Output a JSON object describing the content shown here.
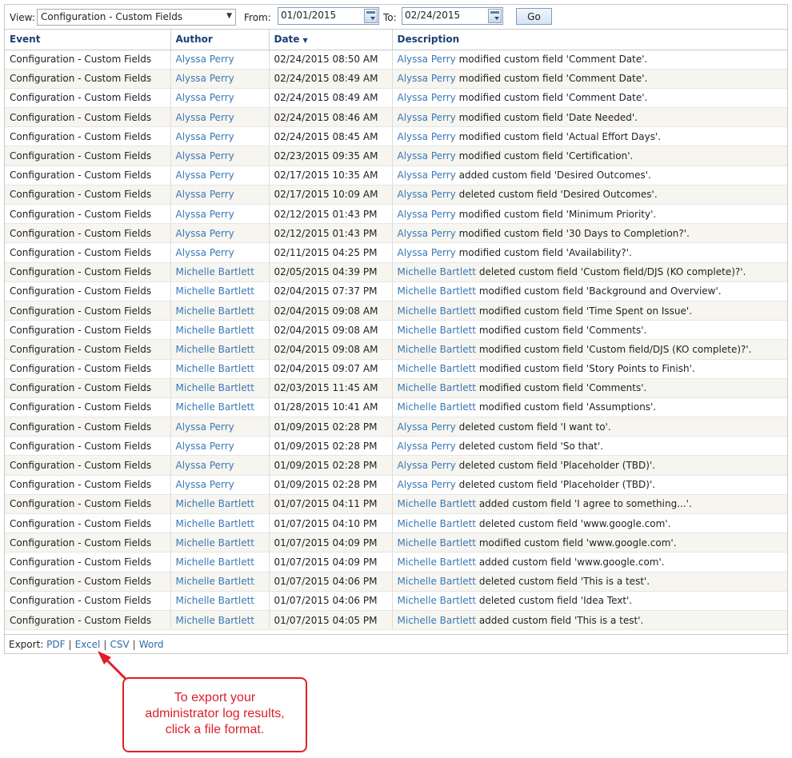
{
  "toolbar": {
    "view_label": "View:",
    "view_value": "Configuration - Custom Fields",
    "from_label": "From:",
    "from_value": "01/01/2015",
    "to_label": "To:",
    "to_value": "02/24/2015",
    "go_label": "Go"
  },
  "columns": {
    "event": "Event",
    "author": "Author",
    "date": "Date",
    "description": "Description"
  },
  "rows": [
    {
      "event": "Configuration - Custom Fields",
      "author": "Alyssa Perry",
      "date": "02/24/2015 08:50 AM",
      "desc": "modified custom field 'Comment Date'."
    },
    {
      "event": "Configuration - Custom Fields",
      "author": "Alyssa Perry",
      "date": "02/24/2015 08:49 AM",
      "desc": "modified custom field 'Comment Date'."
    },
    {
      "event": "Configuration - Custom Fields",
      "author": "Alyssa Perry",
      "date": "02/24/2015 08:49 AM",
      "desc": "modified custom field 'Comment Date'."
    },
    {
      "event": "Configuration - Custom Fields",
      "author": "Alyssa Perry",
      "date": "02/24/2015 08:46 AM",
      "desc": "modified custom field 'Date Needed'."
    },
    {
      "event": "Configuration - Custom Fields",
      "author": "Alyssa Perry",
      "date": "02/24/2015 08:45 AM",
      "desc": "modified custom field 'Actual Effort Days'."
    },
    {
      "event": "Configuration - Custom Fields",
      "author": "Alyssa Perry",
      "date": "02/23/2015 09:35 AM",
      "desc": "modified custom field 'Certification'."
    },
    {
      "event": "Configuration - Custom Fields",
      "author": "Alyssa Perry",
      "date": "02/17/2015 10:35 AM",
      "desc": "added custom field 'Desired Outcomes'."
    },
    {
      "event": "Configuration - Custom Fields",
      "author": "Alyssa Perry",
      "date": "02/17/2015 10:09 AM",
      "desc": "deleted custom field 'Desired Outcomes'."
    },
    {
      "event": "Configuration - Custom Fields",
      "author": "Alyssa Perry",
      "date": "02/12/2015 01:43 PM",
      "desc": "modified custom field 'Minimum Priority'."
    },
    {
      "event": "Configuration - Custom Fields",
      "author": "Alyssa Perry",
      "date": "02/12/2015 01:43 PM",
      "desc": "modified custom field '30 Days to Completion?'."
    },
    {
      "event": "Configuration - Custom Fields",
      "author": "Alyssa Perry",
      "date": "02/11/2015 04:25 PM",
      "desc": "modified custom field 'Availability?'."
    },
    {
      "event": "Configuration - Custom Fields",
      "author": "Michelle Bartlett",
      "date": "02/05/2015 04:39 PM",
      "desc": "deleted custom field 'Custom field/DJS (KO complete)?'."
    },
    {
      "event": "Configuration - Custom Fields",
      "author": "Michelle Bartlett",
      "date": "02/04/2015 07:37 PM",
      "desc": "modified custom field 'Background and Overview'."
    },
    {
      "event": "Configuration - Custom Fields",
      "author": "Michelle Bartlett",
      "date": "02/04/2015 09:08 AM",
      "desc": "modified custom field 'Time Spent on Issue'."
    },
    {
      "event": "Configuration - Custom Fields",
      "author": "Michelle Bartlett",
      "date": "02/04/2015 09:08 AM",
      "desc": "modified custom field 'Comments'."
    },
    {
      "event": "Configuration - Custom Fields",
      "author": "Michelle Bartlett",
      "date": "02/04/2015 09:08 AM",
      "desc": "modified custom field 'Custom field/DJS (KO complete)?'."
    },
    {
      "event": "Configuration - Custom Fields",
      "author": "Michelle Bartlett",
      "date": "02/04/2015 09:07 AM",
      "desc": "modified custom field 'Story Points to Finish'."
    },
    {
      "event": "Configuration - Custom Fields",
      "author": "Michelle Bartlett",
      "date": "02/03/2015 11:45 AM",
      "desc": "modified custom field 'Comments'."
    },
    {
      "event": "Configuration - Custom Fields",
      "author": "Michelle Bartlett",
      "date": "01/28/2015 10:41 AM",
      "desc": "modified custom field 'Assumptions'."
    },
    {
      "event": "Configuration - Custom Fields",
      "author": "Alyssa Perry",
      "date": "01/09/2015 02:28 PM",
      "desc": "deleted custom field 'I want to'."
    },
    {
      "event": "Configuration - Custom Fields",
      "author": "Alyssa Perry",
      "date": "01/09/2015 02:28 PM",
      "desc": "deleted custom field 'So that'."
    },
    {
      "event": "Configuration - Custom Fields",
      "author": "Alyssa Perry",
      "date": "01/09/2015 02:28 PM",
      "desc": "deleted custom field 'Placeholder (TBD)'."
    },
    {
      "event": "Configuration - Custom Fields",
      "author": "Alyssa Perry",
      "date": "01/09/2015 02:28 PM",
      "desc": "deleted custom field 'Placeholder (TBD)'."
    },
    {
      "event": "Configuration - Custom Fields",
      "author": "Michelle Bartlett",
      "date": "01/07/2015 04:11 PM",
      "desc": "added custom field 'I agree to something...'."
    },
    {
      "event": "Configuration - Custom Fields",
      "author": "Michelle Bartlett",
      "date": "01/07/2015 04:10 PM",
      "desc": "deleted custom field 'www.google.com'."
    },
    {
      "event": "Configuration - Custom Fields",
      "author": "Michelle Bartlett",
      "date": "01/07/2015 04:09 PM",
      "desc": "modified custom field 'www.google.com'."
    },
    {
      "event": "Configuration - Custom Fields",
      "author": "Michelle Bartlett",
      "date": "01/07/2015 04:09 PM",
      "desc": "added custom field 'www.google.com'."
    },
    {
      "event": "Configuration - Custom Fields",
      "author": "Michelle Bartlett",
      "date": "01/07/2015 04:06 PM",
      "desc": "deleted custom field 'This is a test'."
    },
    {
      "event": "Configuration - Custom Fields",
      "author": "Michelle Bartlett",
      "date": "01/07/2015 04:06 PM",
      "desc": "deleted custom field 'Idea Text'."
    },
    {
      "event": "Configuration - Custom Fields",
      "author": "Michelle Bartlett",
      "date": "01/07/2015 04:05 PM",
      "desc": "added custom field 'This is a test'."
    }
  ],
  "export": {
    "label": "Export:",
    "formats": [
      "PDF",
      "Excel",
      "CSV",
      "Word"
    ],
    "separator": "|"
  },
  "callout": {
    "lines": [
      "To export your",
      "administrator log results,",
      "click a file format."
    ],
    "color": "#e01e27"
  },
  "colors": {
    "header_text": "#1c3f73",
    "link": "#3a78b5",
    "alt_row": "#f6f5ef"
  }
}
